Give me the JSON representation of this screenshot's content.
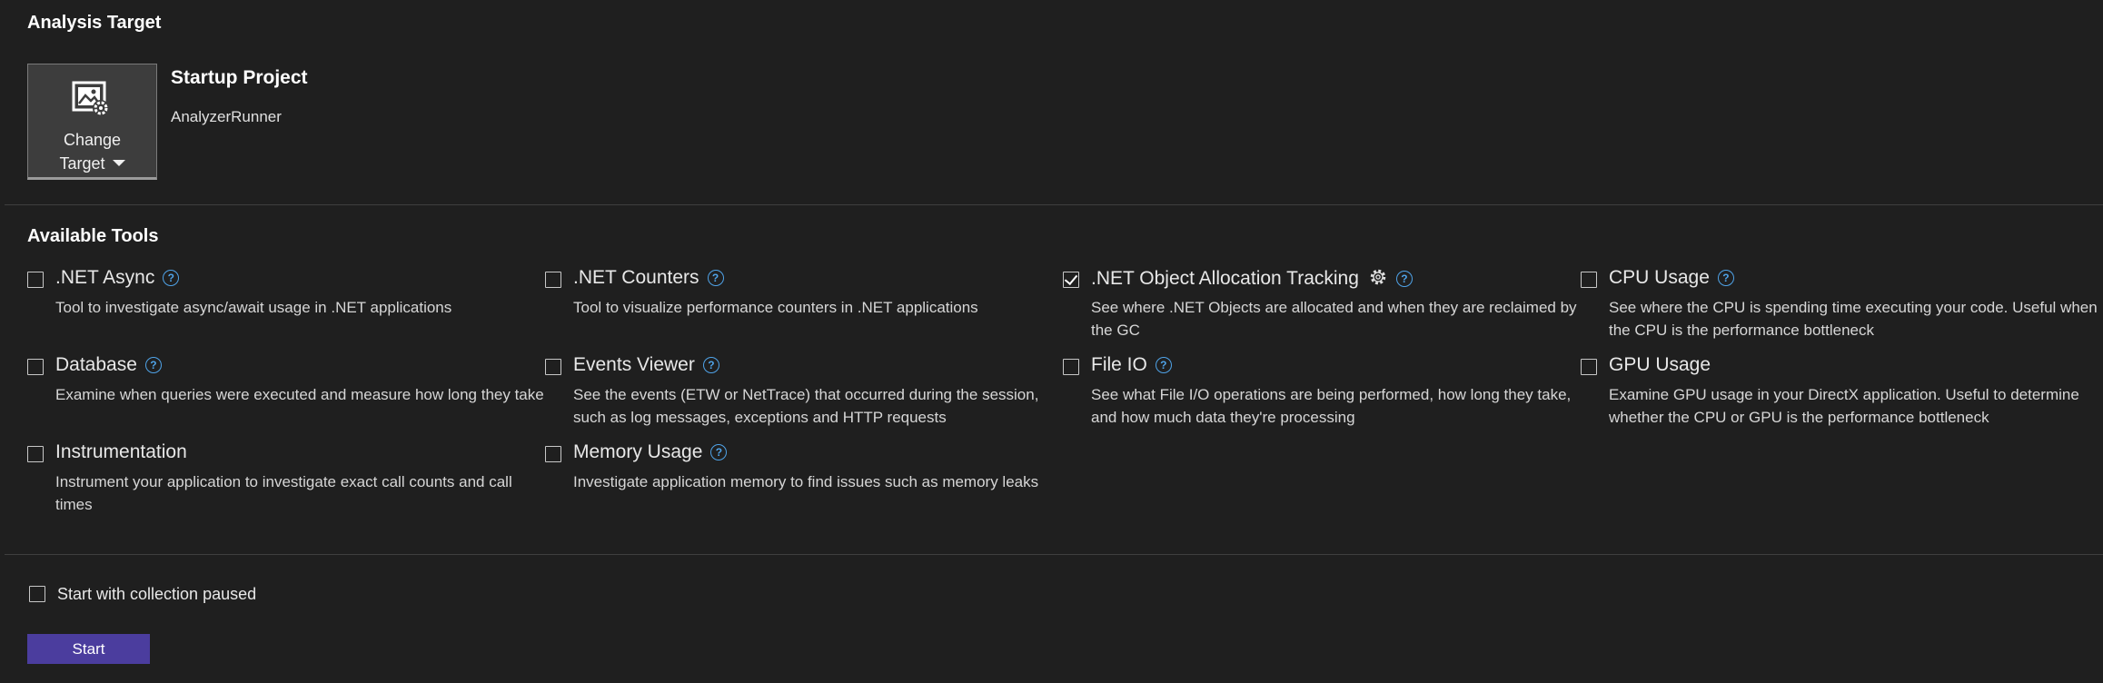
{
  "analysis_target": {
    "title": "Analysis Target",
    "change_target_line1": "Change",
    "change_target_line2": "Target",
    "startup_title": "Startup Project",
    "startup_name": "AnalyzerRunner"
  },
  "available_tools": {
    "title": "Available Tools",
    "tools": [
      {
        "name": ".NET Async",
        "description": "Tool to investigate async/await usage in .NET applications",
        "checked": false,
        "help": true
      },
      {
        "name": ".NET Counters",
        "description": "Tool to visualize performance counters in .NET applications",
        "checked": false,
        "help": true
      },
      {
        "name": ".NET Object Allocation Tracking",
        "description": "See where .NET Objects are allocated and when they are reclaimed by the GC",
        "checked": true,
        "help": true,
        "settings": true
      },
      {
        "name": "CPU Usage",
        "description": "See where the CPU is spending time executing your code. Useful when the CPU is the performance bottleneck",
        "checked": false,
        "help": true
      },
      {
        "name": "Database",
        "description": "Examine when queries were executed and measure how long they take",
        "checked": false,
        "help": true
      },
      {
        "name": "Events Viewer",
        "description": "See the events (ETW or NetTrace) that occurred during the session, such as log messages, exceptions and HTTP requests",
        "checked": false,
        "help": true
      },
      {
        "name": "File IO",
        "description": "See what File I/O operations are being performed, how long they take, and how much data they're processing",
        "checked": false,
        "help": true
      },
      {
        "name": "GPU Usage",
        "description": "Examine GPU usage in your DirectX application. Useful to determine whether the CPU or GPU is the performance bottleneck",
        "checked": false,
        "help": false
      },
      {
        "name": "Instrumentation",
        "description": "Instrument your application to investigate exact call counts and call times",
        "checked": false,
        "help": false
      },
      {
        "name": "Memory Usage",
        "description": "Investigate application memory to find issues such as memory leaks",
        "checked": false,
        "help": true
      }
    ]
  },
  "footer": {
    "paused_label": "Start with collection paused",
    "paused_checked": false,
    "start_label": "Start"
  },
  "colors": {
    "background": "#1f1f1f",
    "accent": "#4b3d9e",
    "help": "#4fa3e8"
  }
}
